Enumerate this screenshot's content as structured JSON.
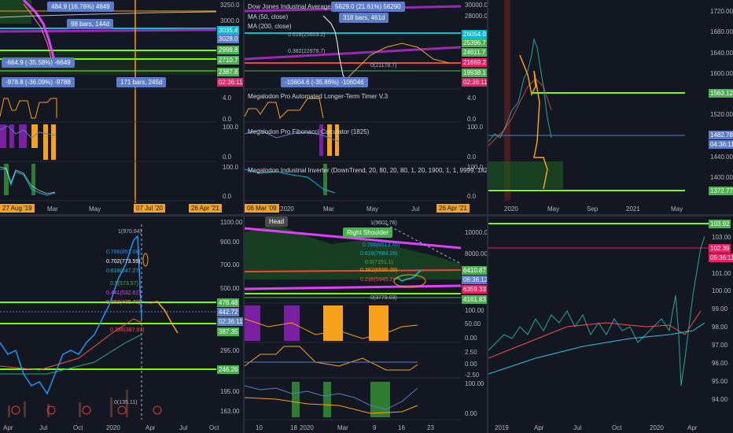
{
  "panels": {
    "p1": {
      "measure_boxes": [
        "484.9 (16.76%) 4849",
        "98 bars, 144d",
        "-664.9 (-35.58%) -6649",
        "-978.8 (-36.09%) -9788",
        "171 bars, 245d"
      ],
      "price_scale": [
        "3250.0",
        "3000.0",
        "2750.0",
        "2500.0"
      ],
      "price_tags": [
        {
          "v": "3035.4",
          "c": "#00bcd4"
        },
        {
          "v": "3028.0",
          "c": "#5b7cc6"
        },
        {
          "v": "2998.8",
          "c": "#4caf50"
        },
        {
          "v": "2710.7",
          "c": "#4caf50"
        },
        {
          "v": "2387.8",
          "c": "#4caf50"
        },
        {
          "v": "02:36:11",
          "c": "#e91e63"
        }
      ],
      "ind_scale_a": [
        "4.0",
        "0.0"
      ],
      "ind_scale_b": [
        "100.0",
        "0.0"
      ],
      "ind_scale_c": [
        "100.0",
        "0.0"
      ],
      "time_axis": [
        "27 Aug '19",
        "Mar",
        "May",
        "07 Jul '20",
        "26 Apr '21"
      ]
    },
    "p2": {
      "legend": [
        "Dow Jones Industrial Average Index, 1D",
        "MA (50, close)",
        "MA (200, close)"
      ],
      "fib_labels": [
        "0.618(25603.2)",
        "0.382(22979.7)",
        "0(21178.7)"
      ],
      "measure_box": "-10604.6 (-35.86%) -106046",
      "top_box": "5629.0 (21.61%) 56290",
      "bars_box": "318 bars, 461d",
      "price_scale": [
        "30000.0",
        "28000.0",
        "26000.0",
        "24000.0",
        "22000.0",
        "20000.0"
      ],
      "price_tags": [
        {
          "v": "26054.0",
          "c": "#00bcd4"
        },
        {
          "v": "25396.7",
          "c": "#4caf50"
        },
        {
          "v": "24611.7",
          "c": "#4caf50"
        },
        {
          "v": "21669.2",
          "c": "#e91e63"
        },
        {
          "v": "19938.1",
          "c": "#4caf50"
        },
        {
          "v": "02:36:11",
          "c": "#e91e63"
        }
      ],
      "ind_titles": [
        "Megalodon Pro Automated Longer-Term Timer V.3",
        "Megalodon Pro Fibonacci Calculator (1825)",
        "Megalodon Industrial Inverter (DownTrend, 20, 80, 20, 80, 1, 20, 1900, 1, 1, 9999, 1825)"
      ],
      "ind_scale_a": [
        "4.0",
        "0.0"
      ],
      "ind_scale_b": [
        "100.0",
        "0.0"
      ],
      "ind_scale_c": [
        "100.0",
        "0.0"
      ],
      "time_axis": [
        "06 Mar '09",
        "2020",
        "Mar",
        "May",
        "Jul",
        "26 Apr '21"
      ]
    },
    "p3": {
      "price_scale": [
        "1720.00",
        "1680.00",
        "1640.00",
        "1600.00",
        "1560.00",
        "1520.00",
        "1480.00",
        "1440.00",
        "1400.00",
        "1360.00"
      ],
      "price_tags": [
        {
          "v": "1563.12",
          "c": "#4caf50"
        },
        {
          "v": "1482.78",
          "c": "#5b7cc6"
        },
        {
          "v": "04:36:11",
          "c": "#5b7cc6"
        },
        {
          "v": "1372.77",
          "c": "#4caf50"
        }
      ],
      "time_axis": [
        "2020",
        "May",
        "Sep",
        "2021",
        "May"
      ]
    },
    "p4": {
      "fib_labels": [
        "1(970.64)",
        "0.786(851.08)",
        "0.702(773.59)",
        "0.618(647.27)",
        "0.5(573.57)",
        "0.441(532.62)",
        "0.382(479.78)",
        "0.236(387.93)",
        "0(135.11)"
      ],
      "price_scale": [
        "1100.00",
        "900.00",
        "700.00",
        "500.00",
        "295.00",
        "195.00",
        "163.00"
      ],
      "price_tags": [
        {
          "v": "478.48",
          "c": "#4caf50"
        },
        {
          "v": "442.72",
          "c": "#5b7cc6"
        },
        {
          "v": "02:36:11",
          "c": "#5b7cc6"
        },
        {
          "v": "387.35",
          "c": "#4caf50"
        },
        {
          "v": "246.26",
          "c": "#4caf50"
        }
      ],
      "time_axis": [
        "Apr",
        "Jul",
        "Oct",
        "2020",
        "Apr",
        "Jul",
        "Oct"
      ]
    },
    "p5": {
      "labels": {
        "head": "Head",
        "right_shoulder": "Right Shoulder"
      },
      "fib_labels": [
        "1(9602.76)",
        "0.786(8513.48)",
        "0.618(7684.26)",
        "0.5(7151.1)",
        "0.382(6595.09)",
        "0.236(5945.2)",
        "0(3779.03)"
      ],
      "price_scale": [
        "10000.00",
        "8000.00"
      ],
      "price_tags": [
        {
          "v": "6410.87",
          "c": "#4caf50"
        },
        {
          "v": "06:36:12",
          "c": "#5b7cc6"
        },
        {
          "v": "6359.33",
          "c": "#e91e63"
        },
        {
          "v": "4161.83",
          "c": "#4caf50"
        }
      ],
      "ind_scale_a": [
        "100.00",
        "50.00",
        "0.00"
      ],
      "ind_scale_b": [
        "2.50",
        "0.00",
        "-2.50"
      ],
      "ind_scale_c": [
        "100.00",
        "0.00"
      ],
      "time_axis": [
        "10",
        "18",
        "2020",
        "Mar",
        "9",
        "16",
        "23"
      ]
    },
    "p6": {
      "price_scale": [
        "103.00",
        "102.00",
        "101.00",
        "100.00",
        "99.00",
        "98.00",
        "97.00",
        "96.00",
        "95.00",
        "94.00"
      ],
      "price_tags": [
        {
          "v": "103.92",
          "c": "#4caf50"
        },
        {
          "v": "102.39",
          "c": "#e91e63"
        },
        {
          "v": "05:36:11",
          "c": "#e91e63"
        }
      ],
      "time_axis": [
        "2019",
        "Apr",
        "Jul",
        "Oct",
        "2020",
        "Apr"
      ]
    }
  }
}
